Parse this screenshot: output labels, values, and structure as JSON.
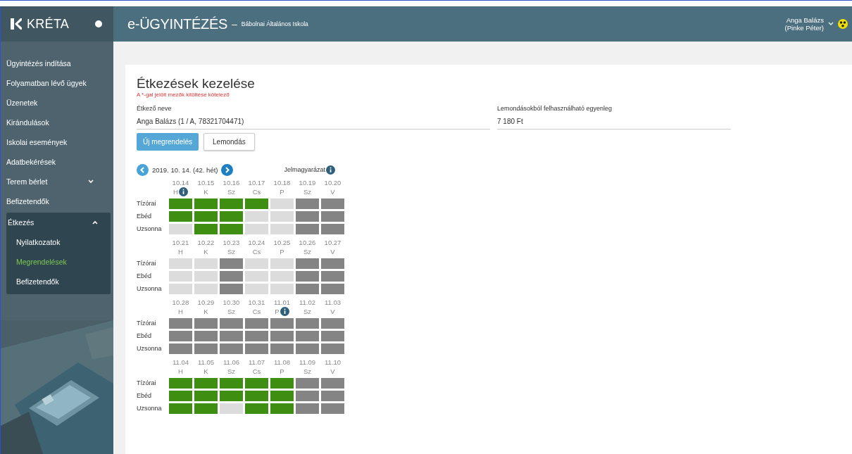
{
  "brand": {
    "name": "KRÉTA"
  },
  "header": {
    "title": "e-ÜGYINTÉZÉS",
    "separator": "–",
    "school": "Bábolnai Általános Iskola",
    "user_name": "Anga Balázs",
    "user_sub": "(Pinke Péter)"
  },
  "sidebar": {
    "items": [
      {
        "label": "Ügyintézés indítása",
        "selected": false
      },
      {
        "label": "Folyamatban lévő ügyek",
        "selected": false
      },
      {
        "label": "Üzenetek",
        "selected": false
      },
      {
        "label": "Kirándulások",
        "selected": false
      },
      {
        "label": "Iskolai események",
        "selected": false
      },
      {
        "label": "Adatbekérések",
        "selected": false
      },
      {
        "label": "Terem bérlet",
        "selected": false,
        "expanded": false
      },
      {
        "label": "Befizetendők",
        "selected": false
      },
      {
        "label": "Étkezés",
        "selected": false,
        "expanded": true,
        "children": [
          {
            "label": "Nyilatkozatok",
            "selected": false
          },
          {
            "label": "Megrendelések",
            "selected": true
          },
          {
            "label": "Befizetendők",
            "selected": false
          }
        ]
      }
    ]
  },
  "form": {
    "title": "Étkezések kezelése",
    "required_note": "A *-gal jelölt mezők kitöltése kötelező",
    "fields": [
      {
        "label": "Étkező neve",
        "value": "Anga Balázs (1 / A, 78321704471)"
      },
      {
        "label": "Lemondásokból felhasználható egyenleg",
        "value": "7 180 Ft"
      }
    ],
    "buttons": [
      {
        "label": "Új megrendelés",
        "kind": "primary"
      },
      {
        "label": "Lemondás",
        "kind": "secondary"
      }
    ]
  },
  "calendar": {
    "week_label": "2019. 10. 14. (42. hét)",
    "legend": "Jelmagyarázat",
    "weeks": [
      {
        "days": [
          {
            "date": "10.14",
            "day": "H",
            "info": true
          },
          {
            "date": "10.15",
            "day": "K",
            "info": false
          },
          {
            "date": "10.16",
            "day": "Sz",
            "info": false
          },
          {
            "date": "10.17",
            "day": "Cs",
            "info": false
          },
          {
            "date": "10.18",
            "day": "P",
            "info": false
          },
          {
            "date": "10.19",
            "day": "Sz",
            "info": false
          },
          {
            "date": "10.20",
            "day": "V",
            "info": false
          }
        ],
        "meals": [
          {
            "label": "Tízórai",
            "cells": [
              {
                "kind": "ordered"
              },
              {
                "kind": "ordered"
              },
              {
                "kind": "ordered"
              },
              {
                "kind": "ordered"
              },
              {
                "kind": "open"
              },
              {
                "kind": "closed"
              },
              {
                "kind": "closed"
              }
            ]
          },
          {
            "label": "Ebéd",
            "cells": [
              {
                "kind": "ordered"
              },
              {
                "kind": "ordered"
              },
              {
                "kind": "ordered"
              },
              {
                "kind": "open"
              },
              {
                "kind": "open"
              },
              {
                "kind": "closed"
              },
              {
                "kind": "closed"
              }
            ]
          },
          {
            "label": "Uzsonna",
            "cells": [
              {
                "kind": "open"
              },
              {
                "kind": "ordered"
              },
              {
                "kind": "ordered"
              },
              {
                "kind": "open"
              },
              {
                "kind": "open"
              },
              {
                "kind": "closed"
              },
              {
                "kind": "closed"
              }
            ]
          }
        ]
      },
      {
        "days": [
          {
            "date": "10.21",
            "day": "H",
            "info": false
          },
          {
            "date": "10.22",
            "day": "K",
            "info": false
          },
          {
            "date": "10.23",
            "day": "Sz",
            "info": false
          },
          {
            "date": "10.24",
            "day": "Cs",
            "info": false
          },
          {
            "date": "10.25",
            "day": "P",
            "info": false
          },
          {
            "date": "10.26",
            "day": "Sz",
            "info": false
          },
          {
            "date": "10.27",
            "day": "V",
            "info": false
          }
        ],
        "meals": [
          {
            "label": "Tízórai",
            "cells": [
              {
                "kind": "open"
              },
              {
                "kind": "open"
              },
              {
                "kind": "closed"
              },
              {
                "kind": "open"
              },
              {
                "kind": "open"
              },
              {
                "kind": "closed"
              },
              {
                "kind": "closed"
              }
            ]
          },
          {
            "label": "Ebéd",
            "cells": [
              {
                "kind": "open"
              },
              {
                "kind": "open"
              },
              {
                "kind": "closed"
              },
              {
                "kind": "open"
              },
              {
                "kind": "open"
              },
              {
                "kind": "closed"
              },
              {
                "kind": "closed"
              }
            ]
          },
          {
            "label": "Uzsonna",
            "cells": [
              {
                "kind": "open"
              },
              {
                "kind": "open"
              },
              {
                "kind": "closed"
              },
              {
                "kind": "open"
              },
              {
                "kind": "open"
              },
              {
                "kind": "closed"
              },
              {
                "kind": "closed"
              }
            ]
          }
        ]
      },
      {
        "days": [
          {
            "date": "10.28",
            "day": "H",
            "info": false
          },
          {
            "date": "10.29",
            "day": "K",
            "info": false
          },
          {
            "date": "10.30",
            "day": "Sz",
            "info": false
          },
          {
            "date": "10.31",
            "day": "Cs",
            "info": false
          },
          {
            "date": "11.01",
            "day": "P",
            "info": true
          },
          {
            "date": "11.02",
            "day": "Sz",
            "info": false
          },
          {
            "date": "11.03",
            "day": "V",
            "info": false
          }
        ],
        "meals": [
          {
            "label": "Tízórai",
            "cells": [
              {
                "kind": "closed"
              },
              {
                "kind": "closed"
              },
              {
                "kind": "closed"
              },
              {
                "kind": "closed"
              },
              {
                "kind": "closed"
              },
              {
                "kind": "closed"
              },
              {
                "kind": "closed"
              }
            ]
          },
          {
            "label": "Ebéd",
            "cells": [
              {
                "kind": "closed"
              },
              {
                "kind": "closed"
              },
              {
                "kind": "closed"
              },
              {
                "kind": "closed"
              },
              {
                "kind": "closed"
              },
              {
                "kind": "closed"
              },
              {
                "kind": "closed"
              }
            ]
          },
          {
            "label": "Uzsonna",
            "cells": [
              {
                "kind": "closed"
              },
              {
                "kind": "closed"
              },
              {
                "kind": "closed"
              },
              {
                "kind": "closed"
              },
              {
                "kind": "closed"
              },
              {
                "kind": "closed"
              },
              {
                "kind": "closed"
              }
            ]
          }
        ]
      },
      {
        "days": [
          {
            "date": "11.04",
            "day": "H",
            "info": false
          },
          {
            "date": "11.05",
            "day": "K",
            "info": false
          },
          {
            "date": "11.06",
            "day": "Sz",
            "info": false
          },
          {
            "date": "11.07",
            "day": "Cs",
            "info": false
          },
          {
            "date": "11.08",
            "day": "P",
            "info": false
          },
          {
            "date": "11.09",
            "day": "Sz",
            "info": false
          },
          {
            "date": "11.10",
            "day": "V",
            "info": false
          }
        ],
        "meals": [
          {
            "label": "Tízórai",
            "cells": [
              {
                "kind": "ordered"
              },
              {
                "kind": "ordered"
              },
              {
                "kind": "ordered"
              },
              {
                "kind": "ordered"
              },
              {
                "kind": "ordered"
              },
              {
                "kind": "closed"
              },
              {
                "kind": "closed"
              }
            ]
          },
          {
            "label": "Ebéd",
            "cells": [
              {
                "kind": "ordered"
              },
              {
                "kind": "ordered"
              },
              {
                "kind": "ordered"
              },
              {
                "kind": "ordered"
              },
              {
                "kind": "ordered"
              },
              {
                "kind": "closed"
              },
              {
                "kind": "closed"
              }
            ]
          },
          {
            "label": "Uzsonna",
            "cells": [
              {
                "kind": "ordered"
              },
              {
                "kind": "ordered"
              },
              {
                "kind": "open"
              },
              {
                "kind": "ordered"
              },
              {
                "kind": "ordered"
              },
              {
                "kind": "closed"
              },
              {
                "kind": "closed"
              }
            ]
          }
        ]
      }
    ]
  }
}
